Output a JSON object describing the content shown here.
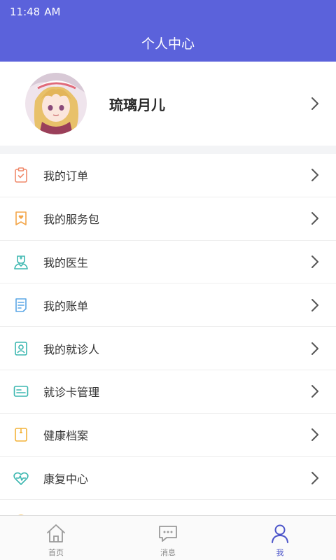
{
  "status_bar": {
    "time": "11:48",
    "ampm": "AM"
  },
  "header": {
    "title": "个人中心"
  },
  "profile": {
    "name": "琉璃月儿"
  },
  "menu": {
    "items": [
      {
        "label": "我的订单",
        "icon": "order-clipboard-icon",
        "color": "#f08a6c"
      },
      {
        "label": "我的服务包",
        "icon": "bookmark-heart-icon",
        "color": "#f3a64a"
      },
      {
        "label": "我的医生",
        "icon": "doctor-icon",
        "color": "#3cb7b0"
      },
      {
        "label": "我的账单",
        "icon": "bill-icon",
        "color": "#5ba7e6"
      },
      {
        "label": "我的就诊人",
        "icon": "patient-badge-icon",
        "color": "#3cb7b0"
      },
      {
        "label": "就诊卡管理",
        "icon": "card-icon",
        "color": "#3cb7b0"
      },
      {
        "label": "健康档案",
        "icon": "archive-icon",
        "color": "#f3b33a"
      },
      {
        "label": "康复中心",
        "icon": "heart-pulse-icon",
        "color": "#3cb7b0"
      }
    ]
  },
  "tabbar": {
    "tabs": [
      {
        "label": "首页",
        "icon": "home-icon",
        "active": false
      },
      {
        "label": "消息",
        "icon": "message-icon",
        "active": false
      },
      {
        "label": "我",
        "icon": "person-icon",
        "active": true
      }
    ]
  },
  "colors": {
    "primary": "#5b62db",
    "active_tab": "#4b54c9"
  }
}
